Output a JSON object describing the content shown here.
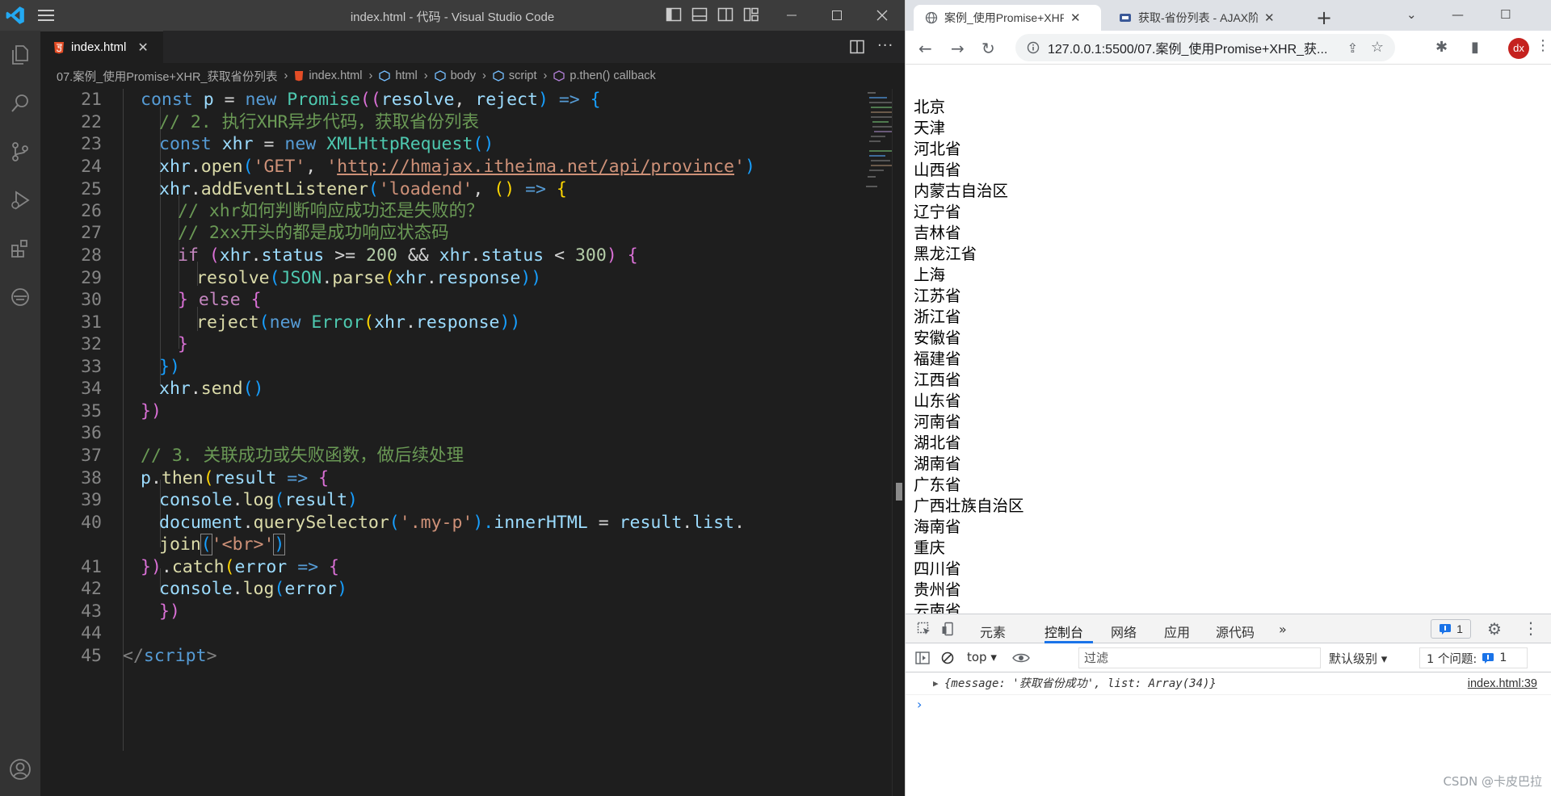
{
  "vscode": {
    "title": "index.html - 代码 - Visual Studio Code",
    "tab": {
      "label": "index.html",
      "close": "✕"
    },
    "breadcrumb": {
      "folder": "07.案例_使用Promise+XHR_获取省份列表",
      "file": "index.html",
      "html": "html",
      "body": "body",
      "script": "script",
      "callback": "p.then() callback"
    },
    "code": [
      {
        "ln": "21"
      },
      {
        "ln": "22"
      },
      {
        "ln": "23"
      },
      {
        "ln": "24"
      },
      {
        "ln": "25"
      },
      {
        "ln": "26"
      },
      {
        "ln": "27"
      },
      {
        "ln": "28"
      },
      {
        "ln": "29"
      },
      {
        "ln": "30"
      },
      {
        "ln": "31"
      },
      {
        "ln": "32"
      },
      {
        "ln": "33"
      },
      {
        "ln": "34"
      },
      {
        "ln": "35"
      },
      {
        "ln": "36"
      },
      {
        "ln": "37"
      },
      {
        "ln": "38"
      },
      {
        "ln": "39"
      },
      {
        "ln": "40"
      },
      {
        "ln": ""
      },
      {
        "ln": "41"
      },
      {
        "ln": "42"
      },
      {
        "ln": "43"
      },
      {
        "ln": "44"
      },
      {
        "ln": "45"
      }
    ],
    "tokens": {
      "l21": [
        "const",
        " ",
        "p",
        " = ",
        "new",
        " ",
        "Promise",
        "((",
        "resolve",
        ", ",
        "reject",
        ") ",
        "=>",
        " {"
      ],
      "l22": "// 2. 执行XHR异步代码，获取省份列表",
      "l23": [
        "const",
        " ",
        "xhr",
        " = ",
        "new",
        " ",
        "XMLHttpRequest",
        "()"
      ],
      "l24": [
        "xhr",
        ".",
        "open",
        "(",
        "'GET'",
        ", ",
        "'",
        "http://hmajax.itheima.net/api/province",
        "'",
        ")"
      ],
      "l25": [
        "xhr",
        ".",
        "addEventListener",
        "(",
        "'loadend'",
        ", ",
        "()",
        " ",
        "=>",
        " {"
      ],
      "l26": "// xhr如何判断响应成功还是失败的？",
      "l27": "// 2xx开头的都是成功响应状态码",
      "l28": [
        "if",
        " (",
        "xhr",
        ".",
        "status",
        " >= ",
        "200",
        " && ",
        "xhr",
        ".",
        "status",
        " < ",
        "300",
        ") {"
      ],
      "l29": [
        "resolve",
        "(",
        "JSON",
        ".",
        "parse",
        "(",
        "xhr",
        ".",
        "response",
        "))"
      ],
      "l30": [
        "}",
        " ",
        "else",
        " {"
      ],
      "l31": [
        "reject",
        "(",
        "new",
        " ",
        "Error",
        "(",
        "xhr",
        ".",
        "response",
        "))"
      ],
      "l32": "}",
      "l33": "})",
      "l34": [
        "xhr",
        ".",
        "send",
        "()"
      ],
      "l35": "})",
      "l37": "// 3. 关联成功或失败函数，做后续处理",
      "l38": [
        "p",
        ".",
        "then",
        "(",
        "result",
        " ",
        "=>",
        " {"
      ],
      "l39": [
        "console",
        ".",
        "log",
        "(",
        "result",
        ")"
      ],
      "l40": [
        "document",
        ".",
        "querySelector",
        "(",
        "'.my-p'",
        ").",
        "innerHTML",
        " = ",
        "result",
        ".",
        "list",
        "."
      ],
      "l40b": [
        "join",
        "(",
        "'<br>'",
        ")"
      ],
      "l41": [
        "})",
        ".",
        "catch",
        "(",
        "error",
        " ",
        "=>",
        " {"
      ],
      "l42": [
        "console",
        ".",
        "log",
        "(",
        "error",
        ")"
      ],
      "l43": "})",
      "l45": [
        "</",
        "script",
        ">"
      ]
    }
  },
  "browser": {
    "tabs": [
      {
        "label": "案例_使用Promise+XHR_获取省份列表",
        "close": "✕"
      },
      {
        "label": "获取-省份列表 - AJAX阶段",
        "close": "✕"
      }
    ],
    "new_tab": "+",
    "url": "127.0.0.1:5500/07.案例_使用Promise+XHR_获...",
    "avatar": "dx",
    "provinces": [
      "北京",
      "天津",
      "河北省",
      "山西省",
      "内蒙古自治区",
      "辽宁省",
      "吉林省",
      "黑龙江省",
      "上海",
      "江苏省",
      "浙江省",
      "安徽省",
      "福建省",
      "江西省",
      "山东省",
      "河南省",
      "湖北省",
      "湖南省",
      "广东省",
      "广西壮族自治区",
      "海南省",
      "重庆",
      "四川省",
      "贵州省",
      "云南省"
    ],
    "devtools": {
      "tabs": [
        "元素",
        "控制台",
        "网络",
        "应用",
        "源代码"
      ],
      "more": "»",
      "issues_badge": "1",
      "context": "top",
      "filter_placeholder": "过滤",
      "level": "默认级别",
      "issues_text": "1 个问题:",
      "issues_count": "1",
      "log_message": "{message: '获取省份成功', list: Array(34)}",
      "log_source": "index.html:39",
      "prompt": "›"
    },
    "watermark": "CSDN @卡皮巴拉"
  },
  "colors": {
    "vscode_bg": "#1e1e1e",
    "accent": "#1a73e8",
    "avatar": "#c5221f"
  }
}
